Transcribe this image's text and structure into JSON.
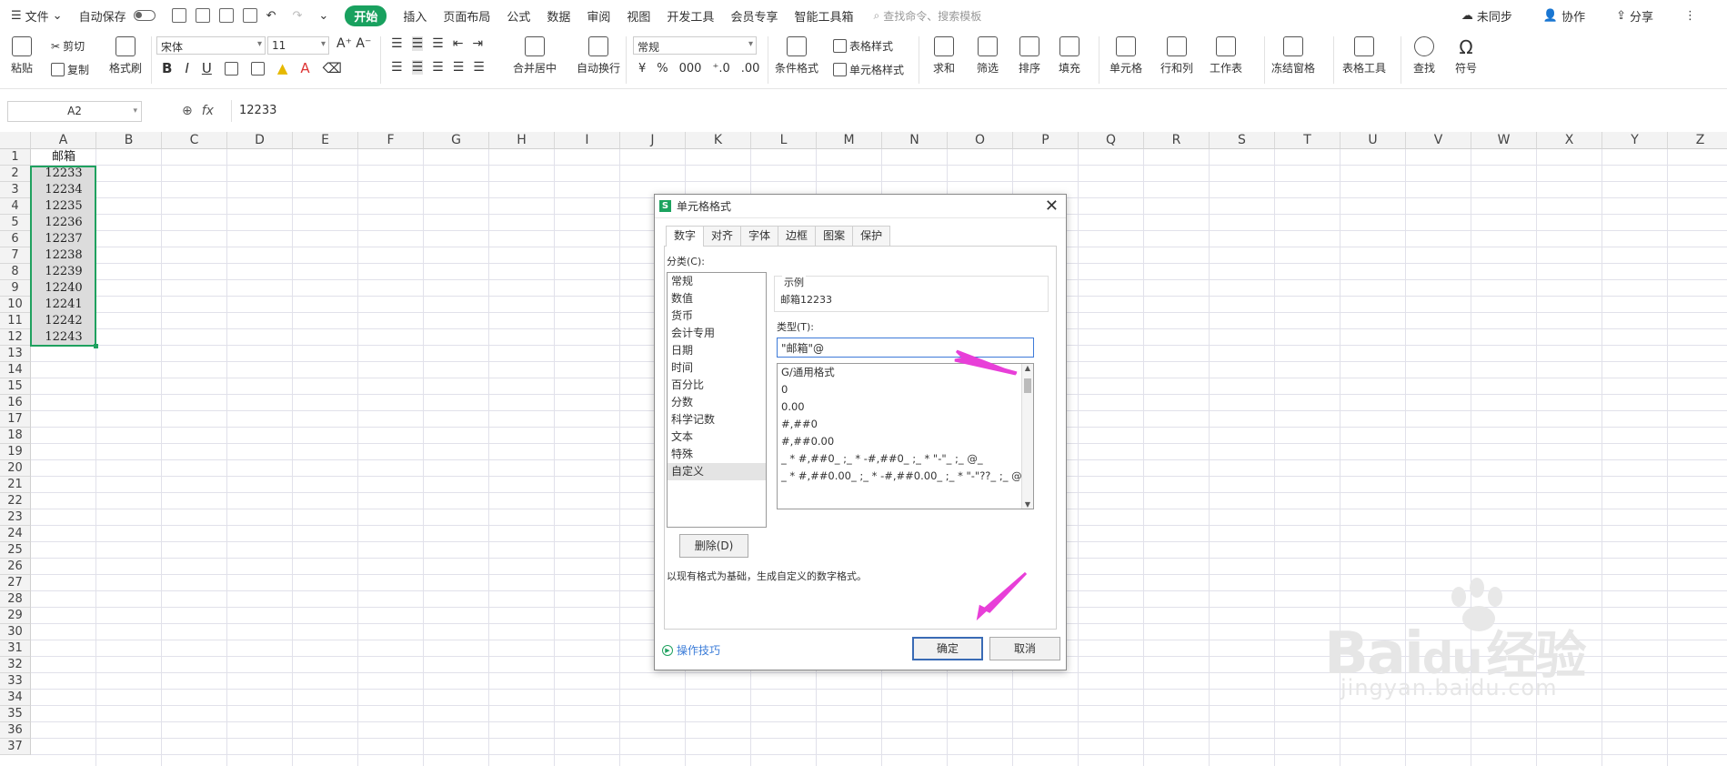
{
  "menubar": {
    "file": "文件",
    "autosave": "自动保存",
    "tabs": [
      "开始",
      "插入",
      "页面布局",
      "公式",
      "数据",
      "审阅",
      "视图",
      "开发工具",
      "会员专享",
      "智能工具箱"
    ],
    "search_placeholder": "查找命令、搜索模板",
    "sync": "未同步",
    "collab": "协作",
    "share": "分享"
  },
  "ribbon": {
    "paste": "粘贴",
    "cut": "剪切",
    "copy": "复制",
    "format_painter": "格式刷",
    "font_name": "宋体",
    "font_size": "11",
    "merge_center": "合并居中",
    "wrap_text": "自动换行",
    "number_format": "常规",
    "conditional_format": "条件格式",
    "table_style": "表格样式",
    "cell_style": "单元格样式",
    "sum": "求和",
    "filter": "筛选",
    "sort": "排序",
    "fill": "填充",
    "cell": "单元格",
    "row_col": "行和列",
    "worksheet": "工作表",
    "freeze": "冻结窗格",
    "table_tools": "表格工具",
    "find": "查找",
    "symbol": "符号"
  },
  "formula_bar": {
    "name_box": "A2",
    "fx": "fx",
    "value": "12233"
  },
  "sheet": {
    "columns": [
      "A",
      "B",
      "C",
      "D",
      "E",
      "F",
      "G",
      "H",
      "I",
      "J",
      "K",
      "L",
      "M",
      "N",
      "O",
      "P",
      "Q",
      "R",
      "S",
      "T",
      "U",
      "V",
      "W",
      "X",
      "Y",
      "Z"
    ],
    "rows": [
      "1",
      "2",
      "3",
      "4",
      "5",
      "6",
      "7",
      "8",
      "9",
      "10",
      "11",
      "12",
      "13",
      "14",
      "15",
      "16",
      "17",
      "18",
      "19",
      "20",
      "21",
      "22",
      "23",
      "24",
      "25",
      "26",
      "27",
      "28",
      "29",
      "30",
      "31",
      "32",
      "33",
      "34",
      "35",
      "36",
      "37"
    ],
    "col_a": [
      "邮箱",
      "12233",
      "12234",
      "12235",
      "12236",
      "12237",
      "12238",
      "12239",
      "12240",
      "12241",
      "12242",
      "12243"
    ]
  },
  "dialog": {
    "title": "单元格格式",
    "close": "✕",
    "tabs": [
      "数字",
      "对齐",
      "字体",
      "边框",
      "图案",
      "保护"
    ],
    "category_label": "分类(C):",
    "categories": [
      "常规",
      "数值",
      "货币",
      "会计专用",
      "日期",
      "时间",
      "百分比",
      "分数",
      "科学记数",
      "文本",
      "特殊",
      "自定义"
    ],
    "example_label": "示例",
    "example_value": "邮箱12233",
    "type_label": "类型(T):",
    "type_value": "\"邮箱\"@",
    "type_list": [
      "G/通用格式",
      "0",
      "0.00",
      "#,##0",
      "#,##0.00",
      "_ * #,##0_ ;_ * -#,##0_ ;_ * \"-\"_ ;_ @_",
      "_ * #,##0.00_ ;_ * -#,##0.00_ ;_ * \"-\"??_ ;_ @_"
    ],
    "delete": "删除(D)",
    "description": "以现有格式为基础，生成自定义的数字格式。",
    "tips": "操作技巧",
    "ok": "确定",
    "cancel": "取消"
  },
  "watermark": {
    "brand": "Bai",
    "brand2": "du",
    "cn": "经验",
    "url": "jingyan.baidu.com"
  },
  "colors": {
    "accent": "#1fa15f",
    "annotation_arrow": "#e83fd8"
  }
}
